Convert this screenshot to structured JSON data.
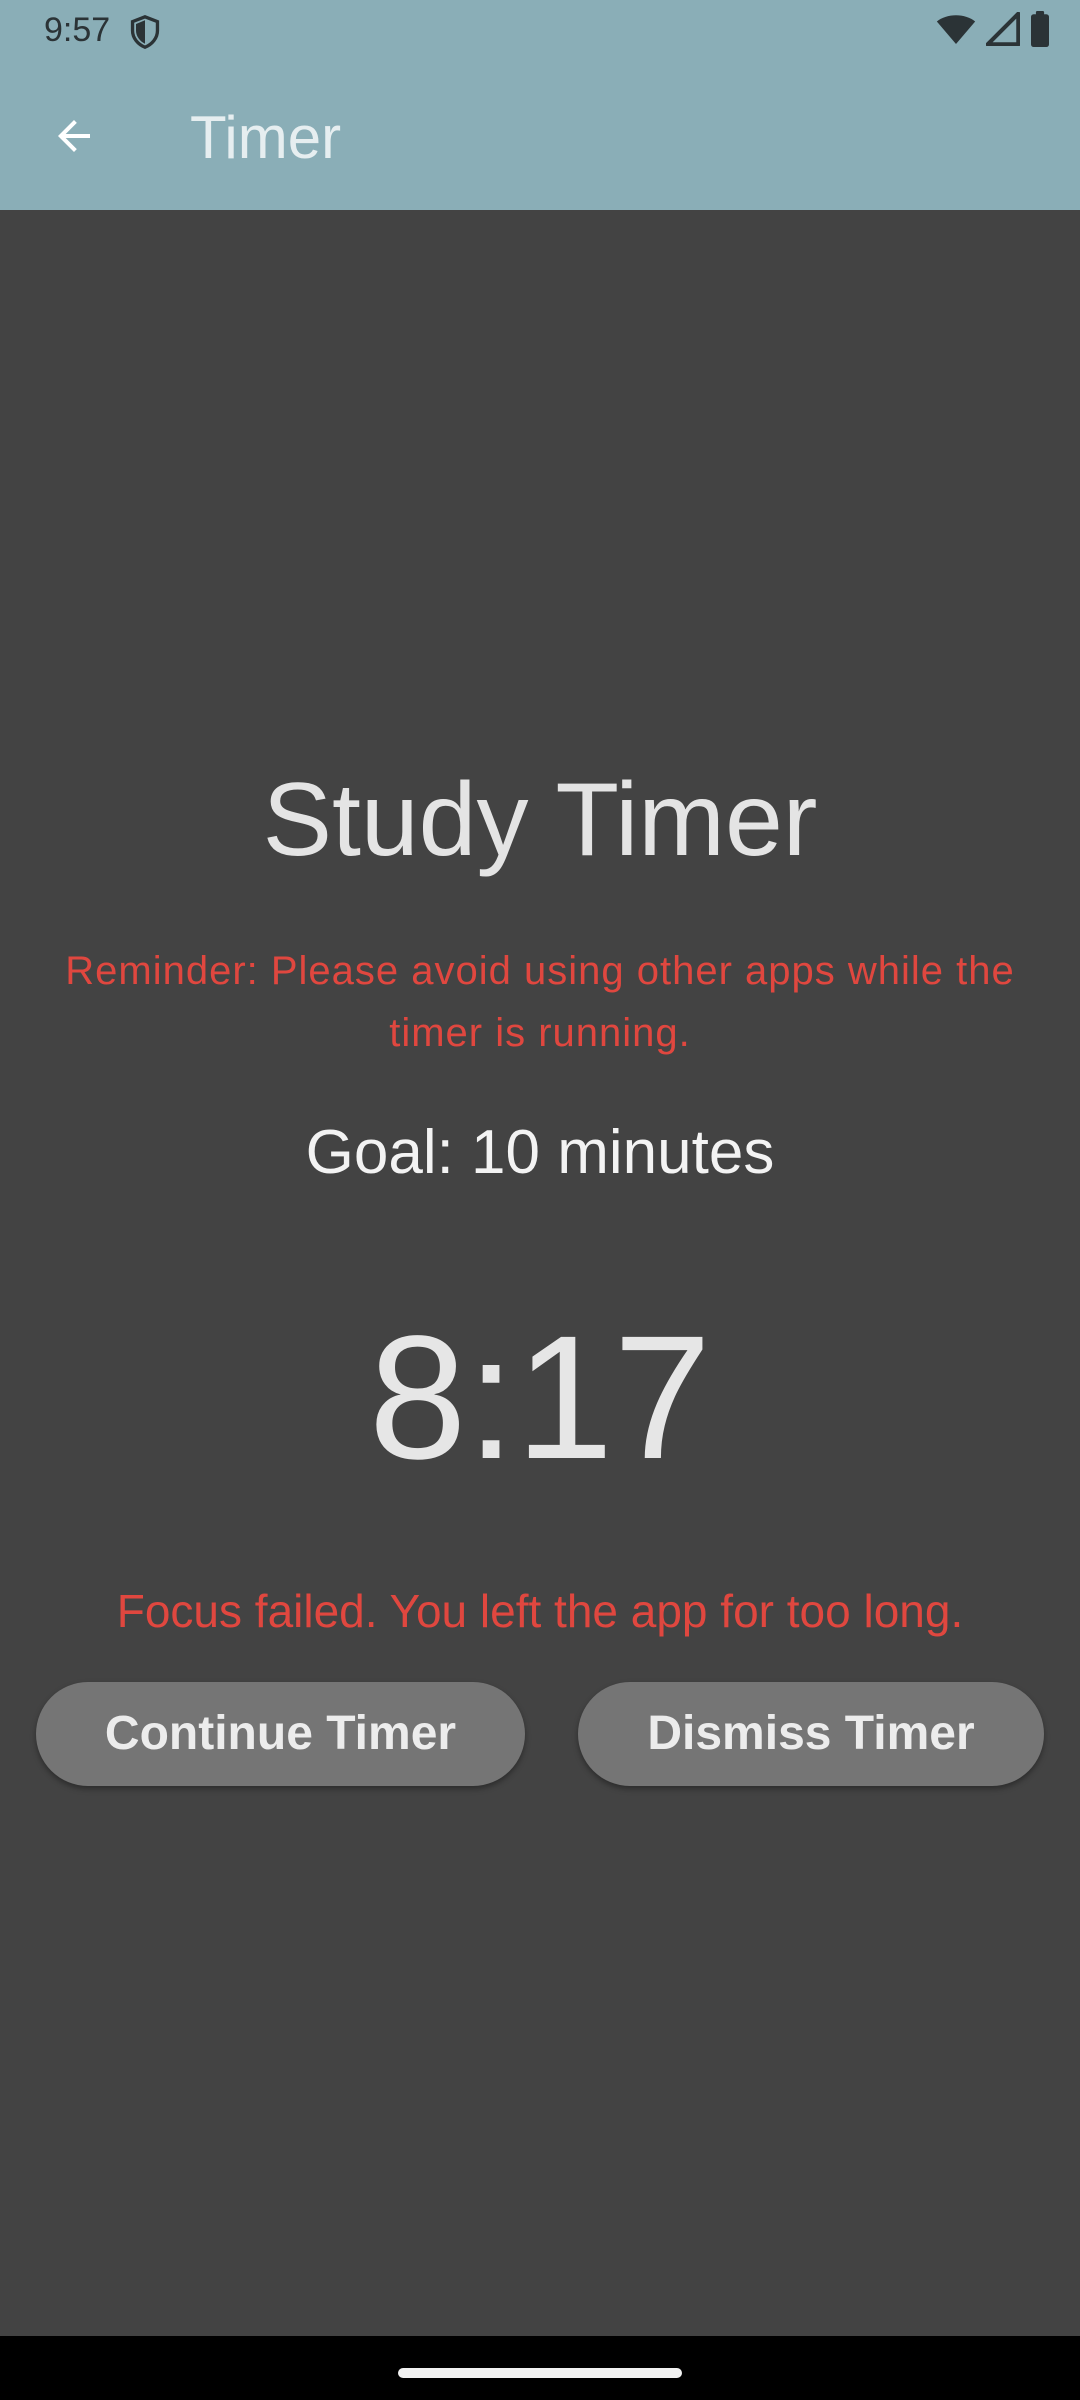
{
  "status_bar": {
    "time": "9:57",
    "icons": [
      "shield-icon",
      "wifi-icon",
      "signal-icon",
      "battery-icon"
    ]
  },
  "app_bar": {
    "title": "Timer",
    "back_icon": "arrow-left-icon"
  },
  "main": {
    "heading": "Study Timer",
    "reminder": "Reminder: Please avoid using other apps while the timer is running.",
    "goal": "Goal: 10 minutes",
    "timer": "8:17",
    "focus_message": "Focus failed. You left the app for too long.",
    "buttons": {
      "continue_label": "Continue Timer",
      "dismiss_label": "Dismiss Timer"
    }
  },
  "colors": {
    "app_bar": "#8aaeb7",
    "background": "#434343",
    "warning": "#e0473f",
    "button": "#757575"
  }
}
